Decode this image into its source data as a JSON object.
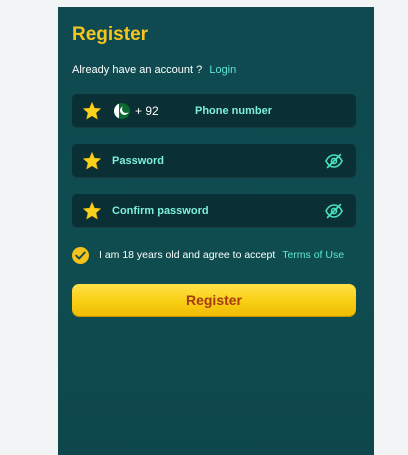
{
  "form": {
    "title": "Register",
    "login_prompt": "Already have an account ?",
    "login_link": "Login",
    "phone": {
      "country_code": "+ 92",
      "label": "Phone number"
    },
    "password": {
      "label": "Password"
    },
    "confirm_password": {
      "label": "Confirm password"
    },
    "terms": {
      "text": "I am 18 years old and agree to accept",
      "link": "Terms of Use",
      "checked": true
    },
    "register_button": "Register"
  },
  "colors": {
    "panel": "#0f4a4f",
    "field": "#0a2f35",
    "accent_yellow": "#f6c51e",
    "link_teal": "#5fe6d2",
    "button_text": "#a63b13"
  },
  "icons": {
    "star": "star-icon",
    "flag": "pakistan-flag-icon",
    "eye": "eye-slash-icon",
    "check": "check-circle-icon"
  }
}
